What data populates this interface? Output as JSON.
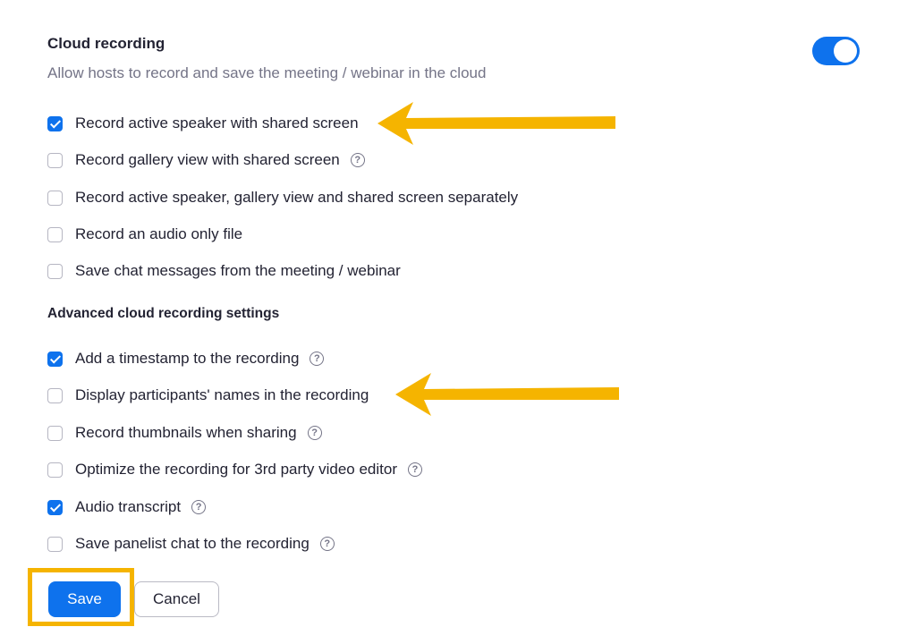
{
  "cloud_recording": {
    "title": "Cloud recording",
    "description": "Allow hosts to record and save the meeting / webinar in the cloud",
    "enabled": true,
    "options": [
      {
        "label": "Record active speaker with shared screen",
        "checked": true,
        "help": false
      },
      {
        "label": "Record gallery view with shared screen",
        "checked": false,
        "help": true
      },
      {
        "label": "Record active speaker, gallery view and shared screen separately",
        "checked": false,
        "help": false
      },
      {
        "label": "Record an audio only file",
        "checked": false,
        "help": false
      },
      {
        "label": "Save chat messages from the meeting / webinar",
        "checked": false,
        "help": false
      }
    ]
  },
  "advanced": {
    "title": "Advanced cloud recording settings",
    "options": [
      {
        "label": "Add a timestamp to the recording",
        "checked": true,
        "help": true
      },
      {
        "label": "Display participants' names in the recording",
        "checked": false,
        "help": false
      },
      {
        "label": "Record thumbnails when sharing",
        "checked": false,
        "help": true
      },
      {
        "label": "Optimize the recording for 3rd party video editor",
        "checked": false,
        "help": true
      },
      {
        "label": "Audio transcript",
        "checked": true,
        "help": true
      },
      {
        "label": "Save panelist chat to the recording",
        "checked": false,
        "help": true
      }
    ]
  },
  "buttons": {
    "save_label": "Save",
    "cancel_label": "Cancel"
  },
  "colors": {
    "accent": "#0e72ed",
    "annotation": "#f5b400"
  },
  "help_glyph": "?"
}
